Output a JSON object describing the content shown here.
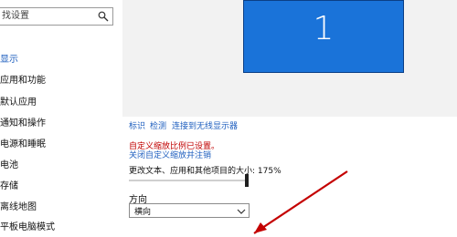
{
  "sidebar": {
    "search_text": "找设置",
    "items": [
      {
        "label": "显示"
      },
      {
        "label": "应用和功能"
      },
      {
        "label": "默认应用"
      },
      {
        "label": "通知和操作"
      },
      {
        "label": "电源和睡眠"
      },
      {
        "label": "电池"
      },
      {
        "label": "存储"
      },
      {
        "label": "离线地图"
      },
      {
        "label": "平板电脑模式"
      }
    ]
  },
  "display": {
    "monitor_number": "1",
    "actions": {
      "identify": "标识",
      "detect": "检测",
      "connect_wireless": "连接到无线显示器"
    },
    "custom_scale_notice": "自定义缩放比例已设置。",
    "turn_off_custom_scale": "关闭自定义缩放并注销",
    "scale_label": "更改文本、应用和其他项目的大小: 175%",
    "orientation": {
      "label": "方向",
      "selected": "横向"
    }
  },
  "colors": {
    "accent": "#1f5fbf",
    "monitor": "#1a73d9",
    "warning": "#c00000",
    "annotation": "#c40000"
  }
}
